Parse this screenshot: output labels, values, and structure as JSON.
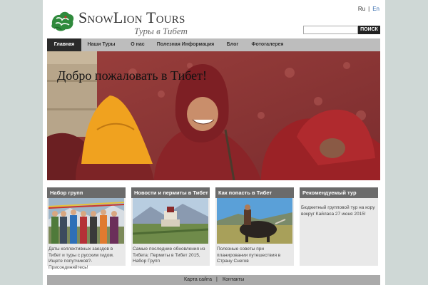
{
  "header": {
    "logo_title": "SnowLion Tours",
    "logo_subtitle": "Туры в Тибет"
  },
  "lang": {
    "ru": "Ru",
    "separator": "|",
    "en": "En"
  },
  "search": {
    "placeholder": "",
    "button_label": "ПОИСК"
  },
  "nav": {
    "items": [
      {
        "label": "Главная",
        "active": true
      },
      {
        "label": "Наши Туры"
      },
      {
        "label": "О нас"
      },
      {
        "label": "Полезная Информация"
      },
      {
        "label": "Блог"
      },
      {
        "label": "Фотогалерея"
      }
    ]
  },
  "hero": {
    "title": "Добро пожаловать в Тибет!"
  },
  "columns": [
    {
      "heading": "Набор групп",
      "text": "Даты коллективных заездов в Тибет и туры с русским гидом. Ищете попутчиков?- Присоединяйтесь!"
    },
    {
      "heading": "Новости и пермиты в Тибет",
      "text": "Самые последние обновления из Тибета: Пермиты в Тибет 2015, Набор Групп"
    },
    {
      "heading": "Как попасть в Тибет",
      "text": "Полезные советы при планировании путешествия в Страну Снегов"
    },
    {
      "heading": "Рекомендуемый тур",
      "text": "Бюджетный групповой тур на кору вокруг Кайласа 27 июня 2015!"
    }
  ],
  "footer": {
    "sitemap": "Карта сайта",
    "separator": "|",
    "contacts": "Контакты"
  },
  "colors": {
    "nav_bg": "#bdbdbd",
    "nav_active": "#2a2a2a",
    "column_head": "#6b6b6b",
    "page_bg": "#cfd8d6"
  }
}
